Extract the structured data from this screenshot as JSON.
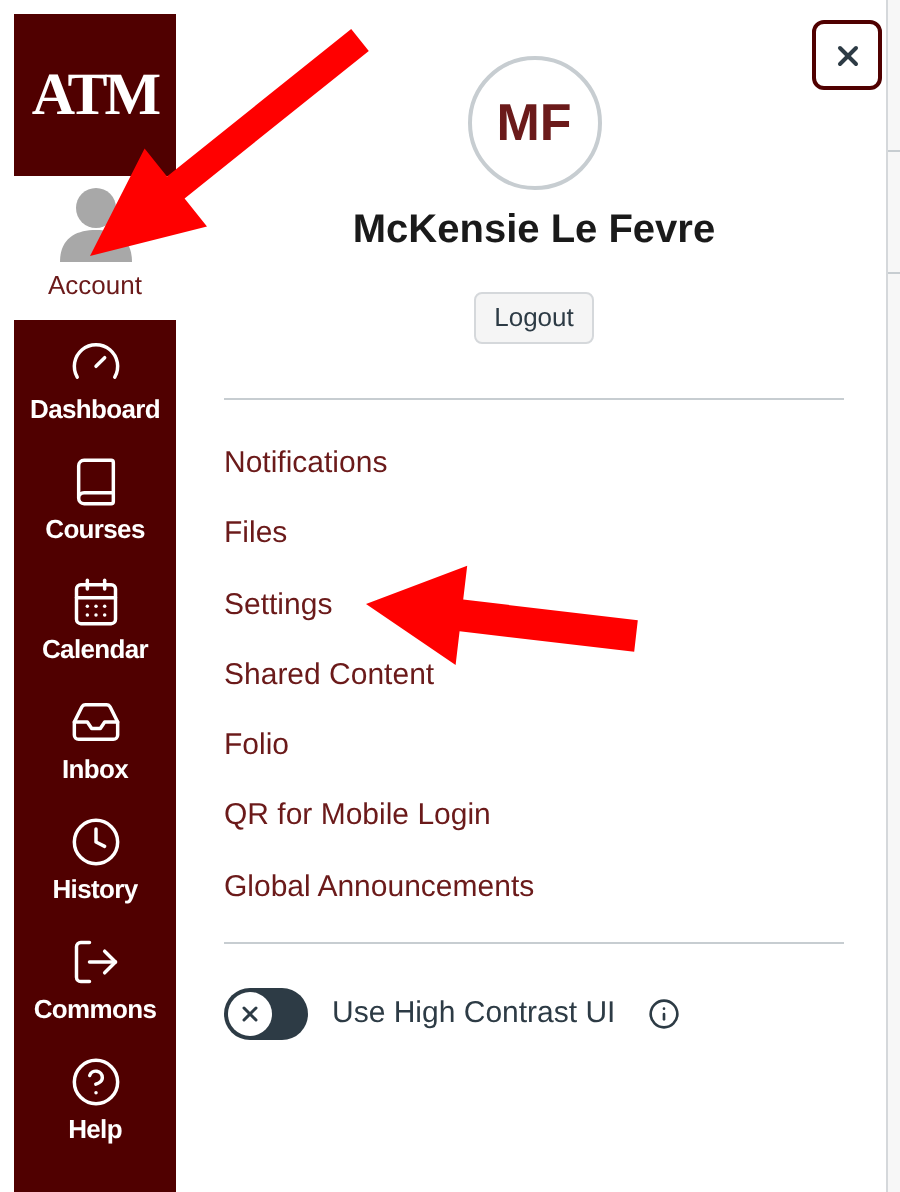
{
  "logo": {
    "text": "ATM"
  },
  "nav": [
    {
      "kind": "account",
      "label": "Account",
      "selected": true
    },
    {
      "kind": "dashboard",
      "label": "Dashboard",
      "selected": false
    },
    {
      "kind": "courses",
      "label": "Courses",
      "selected": false
    },
    {
      "kind": "calendar",
      "label": "Calendar",
      "selected": false
    },
    {
      "kind": "inbox",
      "label": "Inbox",
      "selected": false
    },
    {
      "kind": "history",
      "label": "History",
      "selected": false
    },
    {
      "kind": "commons",
      "label": "Commons",
      "selected": false
    },
    {
      "kind": "help",
      "label": "Help",
      "selected": false
    }
  ],
  "profile": {
    "initials": "MF",
    "name": "McKensie Le Fevre",
    "logout": "Logout"
  },
  "links": [
    "Notifications",
    "Files",
    "Settings",
    "Shared Content",
    "Folio",
    "QR for Mobile Login",
    "Global Announcements"
  ],
  "high_contrast": {
    "label": "Use High Contrast UI",
    "on": false
  }
}
